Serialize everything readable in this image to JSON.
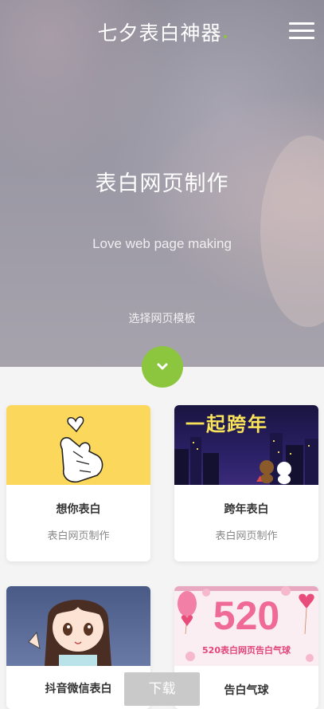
{
  "header": {
    "title": "七夕表白神器",
    "menu_icon": "hamburger-menu-icon",
    "accent_color": "#8cc63f"
  },
  "hero": {
    "heading": "表白网页制作",
    "subheading": "Love web page making",
    "choose_label": "选择网页模板",
    "down_icon": "chevron-down-icon"
  },
  "templates": [
    {
      "title": "想你表白",
      "subtitle": "表白网页制作",
      "thumb_icon": "finger-heart-icon"
    },
    {
      "title": "跨年表白",
      "subtitle": "表白网页制作",
      "thumb_text": "一起跨年"
    },
    {
      "title": "抖音微信表白",
      "thumb_icon": "anime-girl-icon"
    },
    {
      "title": "告白气球",
      "thumb_text": "520",
      "thumb_caption": "520表白网页告白气球"
    }
  ],
  "footer": {
    "download_label": "下载"
  }
}
